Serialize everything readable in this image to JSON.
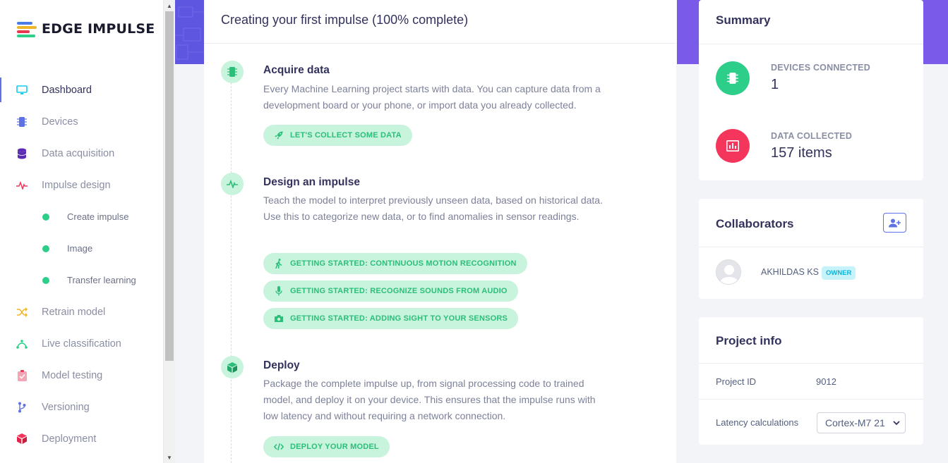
{
  "app": {
    "logo_text": "EDGE IMPULSE"
  },
  "sidebar": {
    "items": [
      {
        "label": "Dashboard",
        "icon": "monitor-icon",
        "active": true
      },
      {
        "label": "Devices",
        "icon": "chip-icon"
      },
      {
        "label": "Data acquisition",
        "icon": "database-icon"
      },
      {
        "label": "Impulse design",
        "icon": "pulse-icon"
      },
      {
        "label": "Create impulse",
        "sub": true
      },
      {
        "label": "Image",
        "sub": true
      },
      {
        "label": "Transfer learning",
        "sub": true
      },
      {
        "label": "Retrain model",
        "icon": "shuffle-icon"
      },
      {
        "label": "Live classification",
        "icon": "bezier-icon"
      },
      {
        "label": "Model testing",
        "icon": "clipboard-check-icon"
      },
      {
        "label": "Versioning",
        "icon": "branch-icon"
      },
      {
        "label": "Deployment",
        "icon": "cube-icon"
      }
    ]
  },
  "main": {
    "title": "Creating your first impulse (100% complete)",
    "steps": [
      {
        "title": "Acquire data",
        "description": "Every Machine Learning project starts with data. You can capture data from a development board or your phone, or import data you already collected.",
        "buttons": [
          {
            "label": "LET'S COLLECT SOME DATA",
            "icon": "rocket-icon"
          }
        ]
      },
      {
        "title": "Design an impulse",
        "description": "Teach the model to interpret previously unseen data, based on historical data. Use this to categorize new data, or to find anomalies in sensor readings.",
        "buttons": [
          {
            "label": "GETTING STARTED: CONTINUOUS MOTION RECOGNITION",
            "icon": "walking-icon"
          },
          {
            "label": "GETTING STARTED: RECOGNIZE SOUNDS FROM AUDIO",
            "icon": "microphone-icon"
          },
          {
            "label": "GETTING STARTED: ADDING SIGHT TO YOUR SENSORS",
            "icon": "camera-icon"
          }
        ]
      },
      {
        "title": "Deploy",
        "description": "Package the complete impulse up, from signal processing code to trained model, and deploy it on your device. This ensures that the impulse runs with low latency and without requiring a network connection.",
        "buttons": [
          {
            "label": "DEPLOY YOUR MODEL",
            "icon": "code-icon"
          }
        ]
      }
    ]
  },
  "summary": {
    "title": "Summary",
    "devices_label": "DEVICES CONNECTED",
    "devices_value": "1",
    "data_label": "DATA COLLECTED",
    "data_value": "157 items"
  },
  "collaborators": {
    "title": "Collaborators",
    "members": [
      {
        "name": "AKHILDAS KS",
        "badge": "OWNER"
      }
    ]
  },
  "project_info": {
    "title": "Project info",
    "project_id_label": "Project ID",
    "project_id_value": "9012",
    "latency_label": "Latency calculations",
    "latency_value": "Cortex-M7 21"
  },
  "colors": {
    "accent": "#5e72e4",
    "success": "#2dce89",
    "danger": "#f5365c",
    "success_light": "#c8f3dc"
  }
}
